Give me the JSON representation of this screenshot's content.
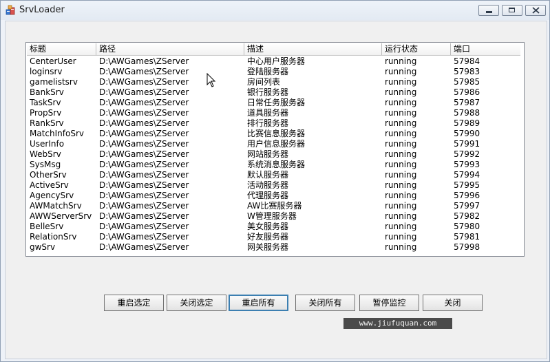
{
  "window": {
    "title": "SrvLoader"
  },
  "list": {
    "columns": [
      "标题",
      "路径",
      "描述",
      "运行状态",
      "端口"
    ],
    "rows": [
      [
        "CenterUser",
        "D:\\AWGames\\ZServer",
        "中心用户服务器",
        "running",
        "57984"
      ],
      [
        "loginsrv",
        "D:\\AWGames\\ZServer",
        "登陆服务器",
        "running",
        "57983"
      ],
      [
        "gamelistsrv",
        "D:\\AWGames\\ZServer",
        "房间列表",
        "running",
        "57985"
      ],
      [
        "BankSrv",
        "D:\\AWGames\\ZServer",
        "银行服务器",
        "running",
        "57986"
      ],
      [
        "TaskSrv",
        "D:\\AWGames\\ZServer",
        "日常任务服务器",
        "running",
        "57987"
      ],
      [
        "PropSrv",
        "D:\\AWGames\\ZServer",
        "道具服务器",
        "running",
        "57988"
      ],
      [
        "RankSrv",
        "D:\\AWGames\\ZServer",
        "排行服务器",
        "running",
        "57989"
      ],
      [
        "MatchInfoSrv",
        "D:\\AWGames\\ZServer",
        "比赛信息服务器",
        "running",
        "57990"
      ],
      [
        "UserInfo",
        "D:\\AWGames\\ZServer",
        "用户信息服务器",
        "running",
        "57991"
      ],
      [
        "WebSrv",
        "D:\\AWGames\\ZServer",
        "网站服务器",
        "running",
        "57992"
      ],
      [
        "SysMsg",
        "D:\\AWGames\\ZServer",
        "系统消息服务器",
        "running",
        "57993"
      ],
      [
        "OtherSrv",
        "D:\\AWGames\\ZServer",
        "默认服务器",
        "running",
        "57994"
      ],
      [
        "ActiveSrv",
        "D:\\AWGames\\ZServer",
        "活动服务器",
        "running",
        "57995"
      ],
      [
        "AgencySrv",
        "D:\\AWGames\\ZServer",
        "代理服务器",
        "running",
        "57996"
      ],
      [
        "AWMatchSrv",
        "D:\\AWGames\\ZServer",
        "AW比赛服务器",
        "running",
        "57997"
      ],
      [
        "AWWServerSrv",
        "D:\\AWGames\\ZServer",
        "W管理服务器",
        "running",
        "57982"
      ],
      [
        "BelleSrv",
        "D:\\AWGames\\ZServer",
        "美女服务器",
        "running",
        "57980"
      ],
      [
        "RelationSrv",
        "D:\\AWGames\\ZServer",
        "好友服务器",
        "running",
        "57981"
      ],
      [
        "gwSrv",
        "D:\\AWGames\\ZServer",
        "网关服务器",
        "running",
        "57998"
      ]
    ]
  },
  "buttons": {
    "restart_selected": "重启选定",
    "close_selected": "关闭选定",
    "restart_all": "重启所有",
    "close_all": "关闭所有",
    "pause_monitor": "暂停监控",
    "close": "关闭"
  },
  "watermark": "www.jiufuquan.com",
  "icons": {
    "app": "srvloader-app-icon",
    "minimize": "minimize-icon",
    "maximize": "maximize-icon",
    "close": "close-icon",
    "cursor": "mouse-pointer-icon"
  }
}
